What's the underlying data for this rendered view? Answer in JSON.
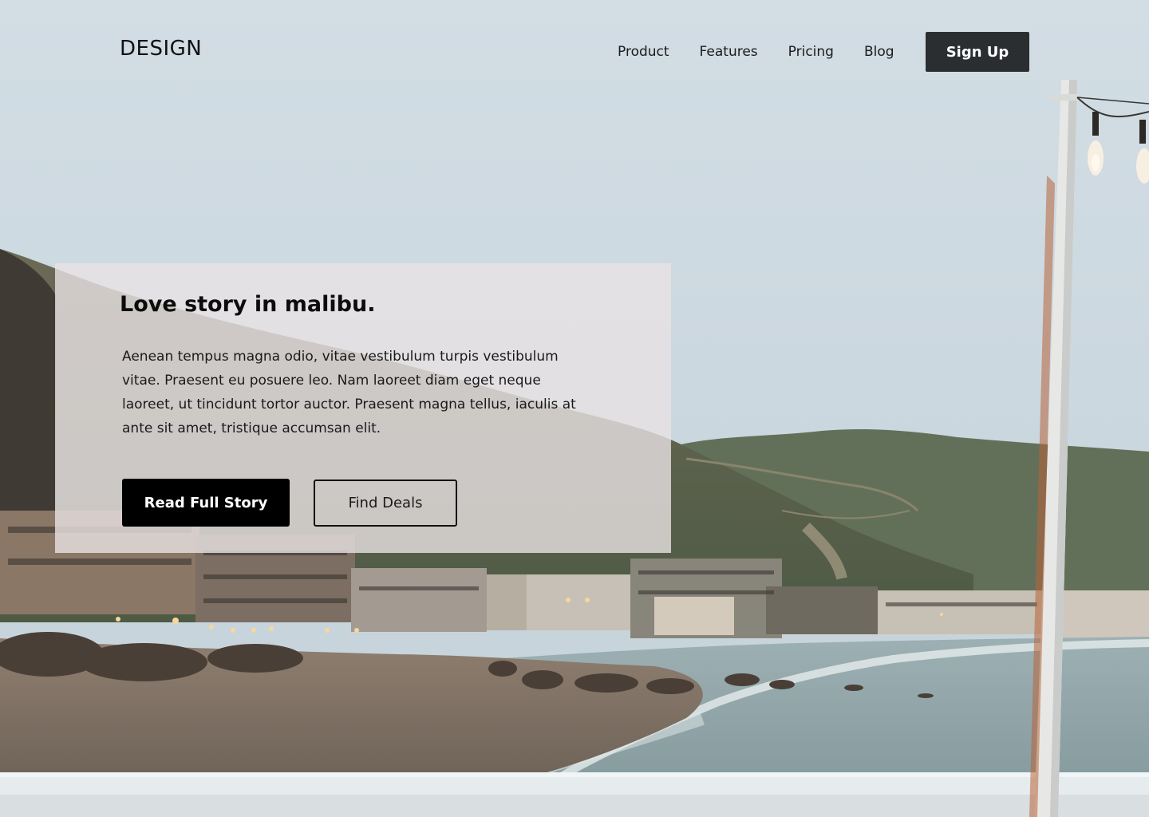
{
  "brand": {
    "logo_text": "DESIGN"
  },
  "nav": {
    "items": [
      {
        "label": "Product"
      },
      {
        "label": "Features"
      },
      {
        "label": "Pricing"
      },
      {
        "label": "Blog"
      }
    ],
    "signup_label": "Sign Up"
  },
  "hero": {
    "title": "Love story in malibu.",
    "body": "Aenean tempus magna odio, vitae vestibulum turpis vestibulum vitae. Praesent eu posuere leo. Nam laoreet diam eget neque laoreet, ut tincidunt tortor auctor. Praesent magna tellus, iaculis at ante sit amet, tristique accumsan elit.",
    "primary_cta": "Read Full Story",
    "secondary_cta": "Find Deals"
  },
  "colors": {
    "sky": "#c9d6de",
    "card_bg": "#e8e2e4",
    "primary_button": "#000000",
    "signup_button": "#2b2e31",
    "text": "#111111"
  }
}
